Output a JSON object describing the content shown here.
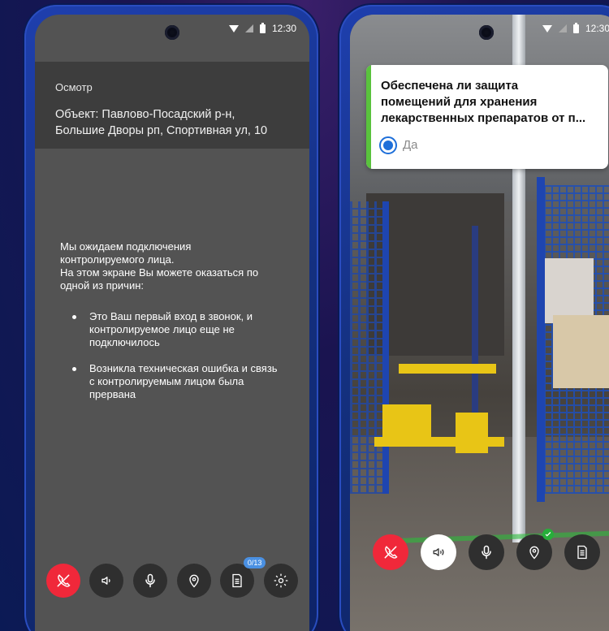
{
  "status": {
    "time": "12:30"
  },
  "left": {
    "header": {
      "title": "Осмотр",
      "object_line1": "Объект: Павлово-Посадский р-н,",
      "object_line2": "Большие Дворы рп, Спортивная ул, 10"
    },
    "waiting": {
      "intro_line1": "Мы ожидаем подключения",
      "intro_line2": "контролируемого лица.",
      "intro_line3": "На этом экране Вы можете оказаться по",
      "intro_line4": "одной из причин:",
      "reasons": [
        {
          "line1": "Это Ваш первый вход в звонок, и",
          "line2": "контролируемое лицо еще не",
          "line3": "подключилось"
        },
        {
          "line1": "Возникла техническая ошибка и связь",
          "line2": "с контролируемым лицом была",
          "line3": "прервана"
        }
      ]
    },
    "controls": {
      "hangup": "phone-hangup-icon",
      "speaker": "speaker-icon",
      "mic": "microphone-icon",
      "location": "location-pin-icon",
      "checklist": "document-icon",
      "checklist_badge": "0/13",
      "settings": "gear-icon"
    }
  },
  "right": {
    "question": {
      "line1": "Обеспечена ли защита",
      "line2": "помещений для хранения",
      "line3": "лекарственных препаратов от п...",
      "answer": "Да"
    },
    "controls": {
      "hangup": "phone-hangup-icon",
      "speaker": "speaker-icon",
      "mic": "microphone-icon",
      "location": "location-pin-icon",
      "checklist": "document-icon"
    }
  },
  "colors": {
    "hangup": "#f0283a",
    "accent_blue": "#1e6fd9",
    "badge_blue": "#4a90e2",
    "answered_green": "#59c23d"
  }
}
